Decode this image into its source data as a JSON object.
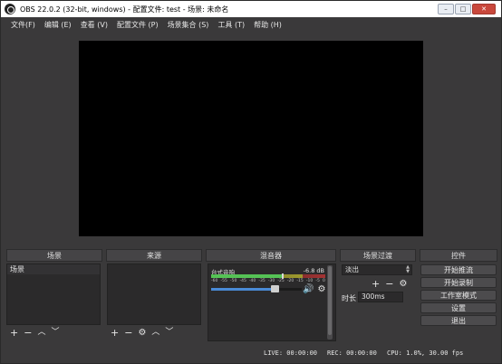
{
  "window": {
    "title": "OBS 22.0.2 (32-bit, windows) - 配置文件: test - 场景: 未命名",
    "buttons": [
      "–",
      "□",
      "✕"
    ]
  },
  "menu": [
    "文件(F)",
    "编辑 (E)",
    "查看 (V)",
    "配置文件 (P)",
    "场景集合 (S)",
    "工具 (T)",
    "帮助 (H)"
  ],
  "docks": {
    "scenes": {
      "title": "场景",
      "items": [
        "场景"
      ]
    },
    "sources": {
      "title": "来源"
    },
    "mixer": {
      "title": "混音器",
      "channel_name": "台式音响",
      "level_db": "-6.8 dB",
      "scale": [
        "-60",
        "-55",
        "-50",
        "-45",
        "-40",
        "-35",
        "-30",
        "-25",
        "-20",
        "-15",
        "-10",
        "-5",
        "0"
      ],
      "meter_level": 0.62,
      "volume": 0.7
    },
    "transitions": {
      "title": "场景过渡",
      "selected": "淡出",
      "duration_label": "时长",
      "duration_value": "300ms"
    },
    "controls": {
      "title": "控件",
      "buttons": [
        "开始推流",
        "开始录制",
        "工作室模式",
        "设置",
        "退出"
      ]
    }
  },
  "status": {
    "live": "LIVE: 00:00:00",
    "rec": "REC: 00:00:00",
    "cpu": "CPU: 1.0%, 30.00 fps"
  }
}
